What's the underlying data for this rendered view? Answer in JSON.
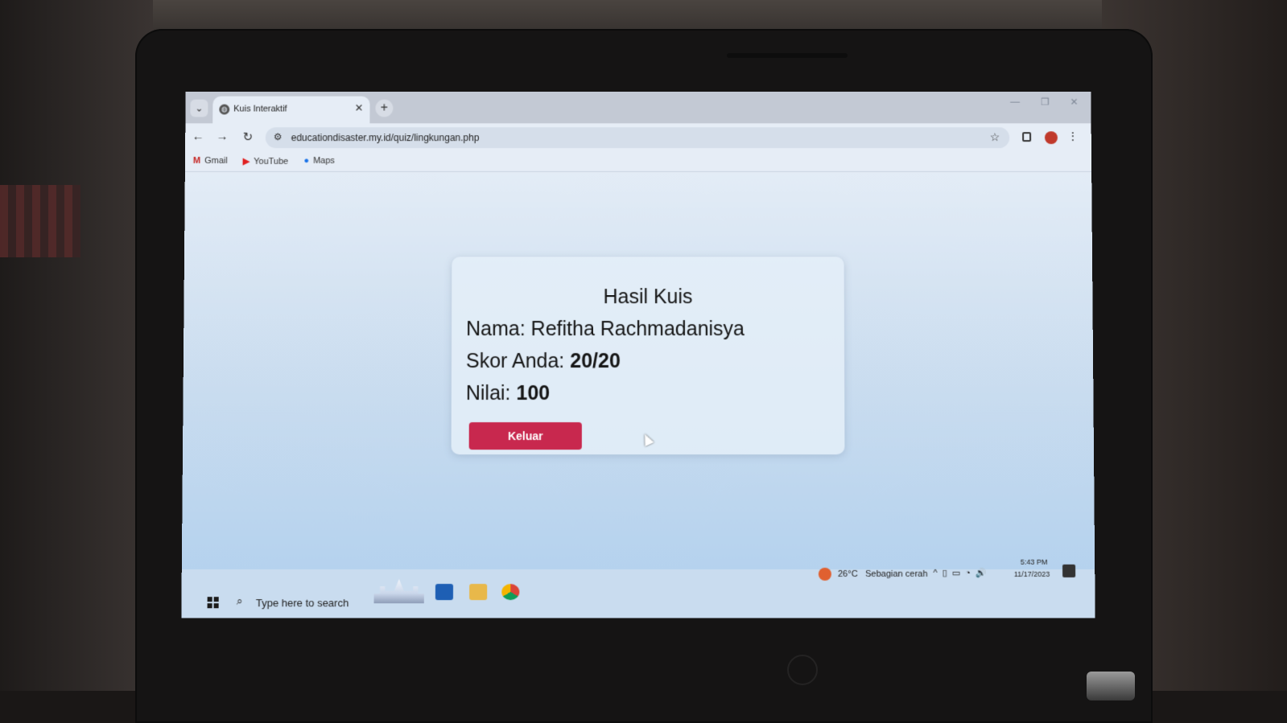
{
  "browser": {
    "tab_title": "Kuis Interaktif",
    "tab_close": "✕",
    "new_tab": "+",
    "url": "educationdisaster.my.id/quiz/lingkungan.php",
    "bookmarks": [
      {
        "label": "Gmail",
        "icon": "gmail-icon"
      },
      {
        "label": "YouTube",
        "icon": "youtube-icon"
      },
      {
        "label": "Maps",
        "icon": "maps-icon"
      }
    ]
  },
  "quiz_result": {
    "title": "Hasil Kuis",
    "name_label": "Nama:",
    "name_value": "Refitha Rachmadanisya",
    "score_label": "Skor Anda:",
    "score_value": "20/20",
    "grade_label": "Nilai:",
    "grade_value": "100",
    "exit_button": "Keluar"
  },
  "taskbar": {
    "search_placeholder": "Type here to search",
    "weather_temp": "26°C",
    "weather_desc": "Sebagian cerah",
    "time": "5:43 PM",
    "date": "11/17/2023"
  },
  "colors": {
    "exit_button": "#c8284e",
    "page_background": "#c9dcef"
  }
}
